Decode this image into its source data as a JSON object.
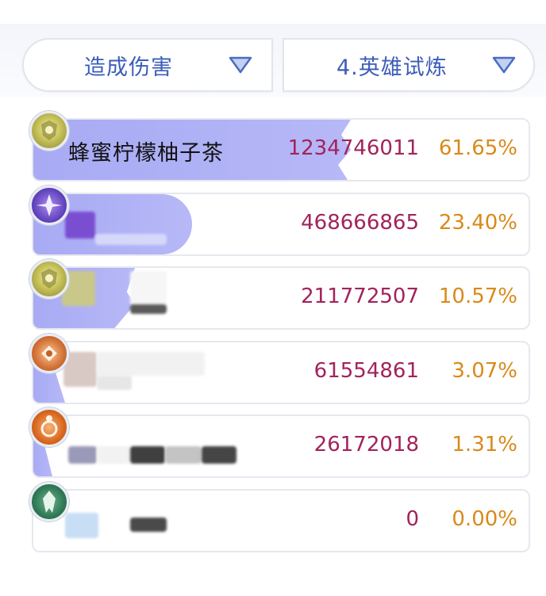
{
  "filters": {
    "left": {
      "label": "造成伤害",
      "icon": "triangle-down-icon"
    },
    "right": {
      "label": "4.英雄试炼",
      "icon": "triangle-down-icon"
    }
  },
  "colors": {
    "accent_blue": "#3c5db8",
    "bar": "#aeb0f5",
    "damage_text": "#a2235c",
    "percent_text": "#d98a1a"
  },
  "rows": [
    {
      "name": "蜂蜜柠檬柚子茶",
      "damage": "1234746011",
      "percent": "61.65%",
      "share": 0.6165,
      "avatar": "golden-lion-emblem-icon",
      "avatar_color": "#b6b24a"
    },
    {
      "name": "",
      "damage": "468666865",
      "percent": "23.40%",
      "share": 0.234,
      "avatar": "purple-shuriken-emblem-icon",
      "avatar_color": "#6a46c8"
    },
    {
      "name": "",
      "damage": "211772507",
      "percent": "10.57%",
      "share": 0.1057,
      "avatar": "golden-lion-emblem-icon",
      "avatar_color": "#b6b24a"
    },
    {
      "name": "",
      "damage": "61554861",
      "percent": "3.07%",
      "share": 0.0307,
      "avatar": "orange-ornate-emblem-icon",
      "avatar_color": "#d06a2c"
    },
    {
      "name": "",
      "damage": "26172018",
      "percent": "1.31%",
      "share": 0.0131,
      "avatar": "orange-ring-emblem-icon",
      "avatar_color": "#d86a22"
    },
    {
      "name": "",
      "damage": "0",
      "percent": "0.00%",
      "share": 0,
      "avatar": "green-crest-emblem-icon",
      "avatar_color": "#2f7a55"
    }
  ]
}
